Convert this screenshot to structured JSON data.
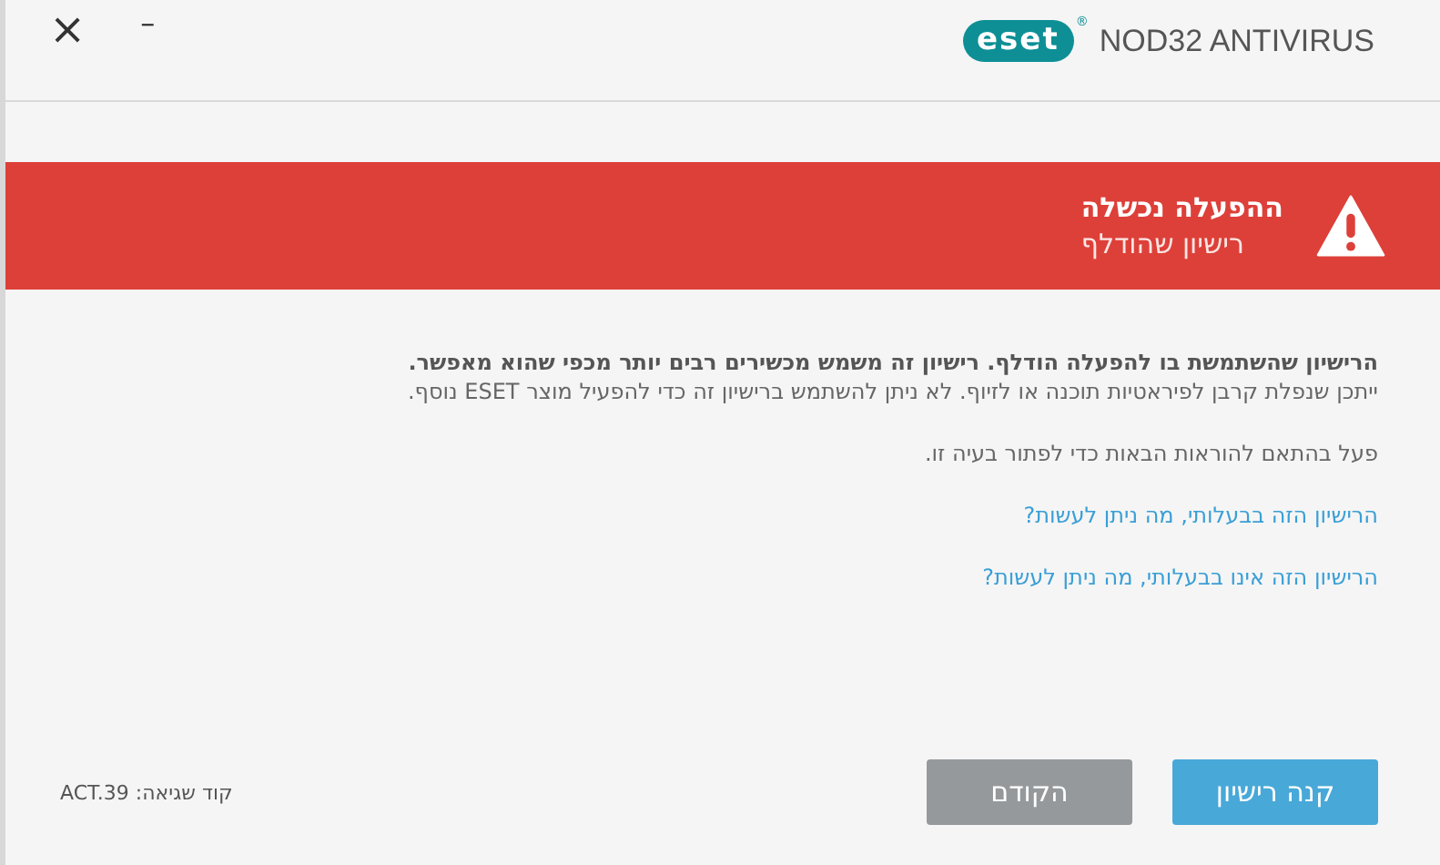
{
  "window": {
    "close_glyph": "×",
    "minimize_glyph": "–"
  },
  "logo": {
    "mark": "eset",
    "registered": "®",
    "product": "NOD32 ANTIVIRUS"
  },
  "banner": {
    "title": "ההפעלה נכשלה",
    "subtitle": "רישיון שהודלף"
  },
  "message": {
    "lead": "הרישיון שהשתמשת בו להפעלה הודלף. רישיון זה משמש מכשירים רבים יותר מכפי שהוא מאפשר.",
    "detail": "ייתכן שנפלת קרבן לפיראטיות תוכנה או לזיוף. לא ניתן להשתמש ברישיון זה כדי להפעיל מוצר ESET נוסף.",
    "instruction": "פעל בהתאם להוראות הבאות כדי לפתור בעיה זו."
  },
  "links": [
    "הרישיון הזה בבעלותי, מה ניתן לעשות?",
    "הרישיון הזה אינו בבעלותי, מה ניתן לעשות?"
  ],
  "footer": {
    "error_code": "קוד שגיאה: ACT.39",
    "buttons": [
      {
        "label": "קנה רישיון",
        "kind": "primary"
      },
      {
        "label": "הקודם",
        "kind": "secondary"
      }
    ]
  }
}
